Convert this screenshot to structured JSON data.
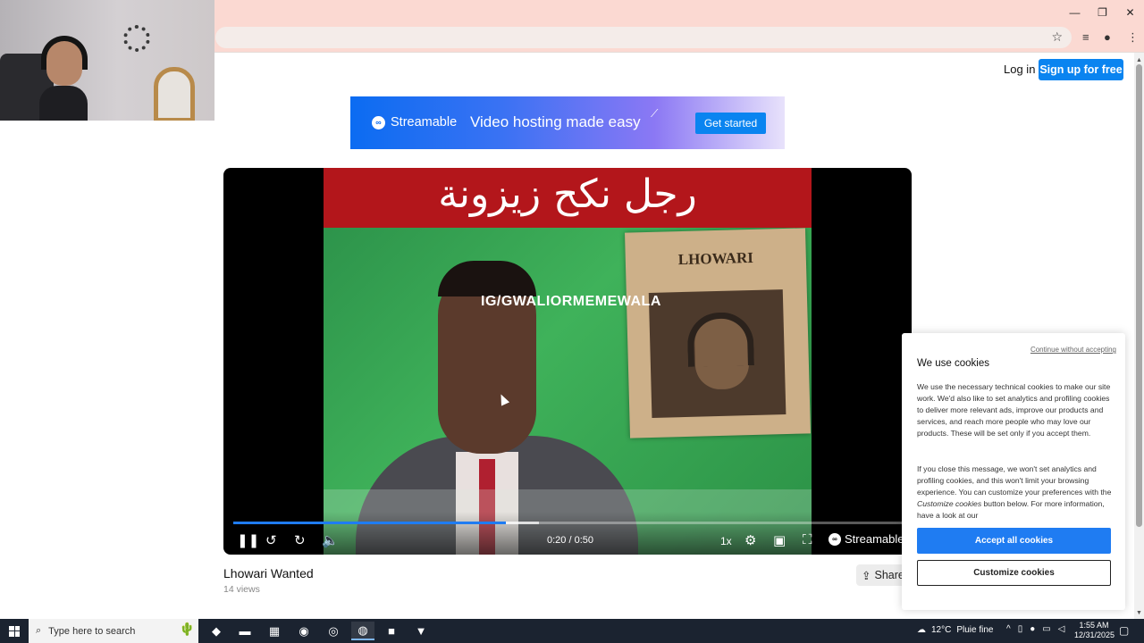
{
  "browser": {
    "window_controls": [
      "—",
      "❐",
      "✕"
    ],
    "star_icon": "star-icon"
  },
  "header": {
    "login_label": "Log in",
    "signup_label": "Sign up for free"
  },
  "banner": {
    "brand": "Streamable",
    "tagline": "Video hosting made easy",
    "cta": "Get started"
  },
  "video": {
    "overlay_title": "رجل نكح زيزونة",
    "watermark": "IG/GWALIORMEMEWALA",
    "poster_name": "LHOWARI",
    "time": "0:20 / 0:50",
    "progress": 0.405,
    "buffered": 0.455,
    "speed": "1x",
    "brand": "Streamable",
    "title": "Lhowari Wanted",
    "views": "14 views",
    "share_label": "Share"
  },
  "cookies": {
    "skip_link": "Continue without accepting",
    "title": "We use cookies",
    "paragraph1": "We use the necessary technical cookies to make our site work. We'd also like to set analytics and profiling cookies to deliver more relevant ads, improve our products and services, and reach more people who may love our products. These will be set only if you accept them.",
    "paragraph2_a": "If you close this message, we won't set analytics and profiling cookies, and this won't limit your browsing experience. You can customize your preferences with the ",
    "paragraph2_em": "Customize cookies",
    "paragraph2_b": " button below. For more information, have a look at our",
    "accept_label": "Accept all cookies",
    "customize_label": "Customize cookies"
  },
  "taskbar": {
    "search_placeholder": "Type here to search",
    "weather_temp": "12°C",
    "weather_text": "Pluie fine",
    "time": "1:55 AM",
    "date": "12/31/2025"
  },
  "colors": {
    "accent": "#1f7cf2",
    "chrome": "#fbd9d2",
    "taskbar": "#1b2330"
  }
}
